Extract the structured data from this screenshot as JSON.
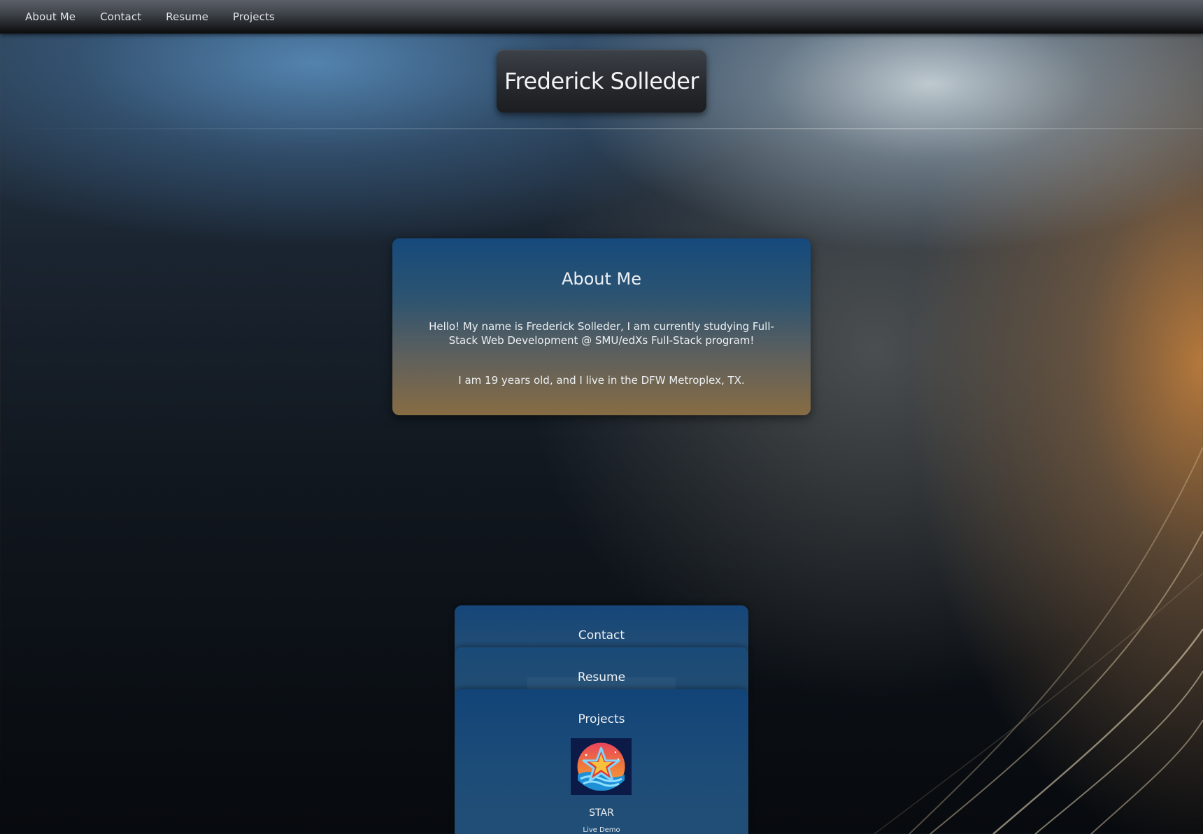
{
  "nav": {
    "items": [
      {
        "label": "About Me"
      },
      {
        "label": "Contact"
      },
      {
        "label": "Resume"
      },
      {
        "label": "Projects"
      }
    ]
  },
  "header": {
    "title": "Frederick Solleder"
  },
  "about": {
    "heading": "About Me",
    "paragraph_1": "Hello! My name is Frederick Solleder, I am currently studying Full-Stack Web Development @ SMU/edXs Full-Stack program!",
    "paragraph_2": "I am 19 years old, and I live in the DFW Metroplex, TX."
  },
  "contact": {
    "heading": "Contact"
  },
  "resume": {
    "heading": "Resume"
  },
  "projects": {
    "heading": "Projects",
    "items": [
      {
        "name": "STAR",
        "link_label": "Live Demo",
        "icon": "star-logo-icon"
      }
    ]
  },
  "colors": {
    "card_top": "#154a7c",
    "card_bottom": "#876c43",
    "nav_bg": "#2b2e33",
    "title_bg": "#25282c"
  }
}
